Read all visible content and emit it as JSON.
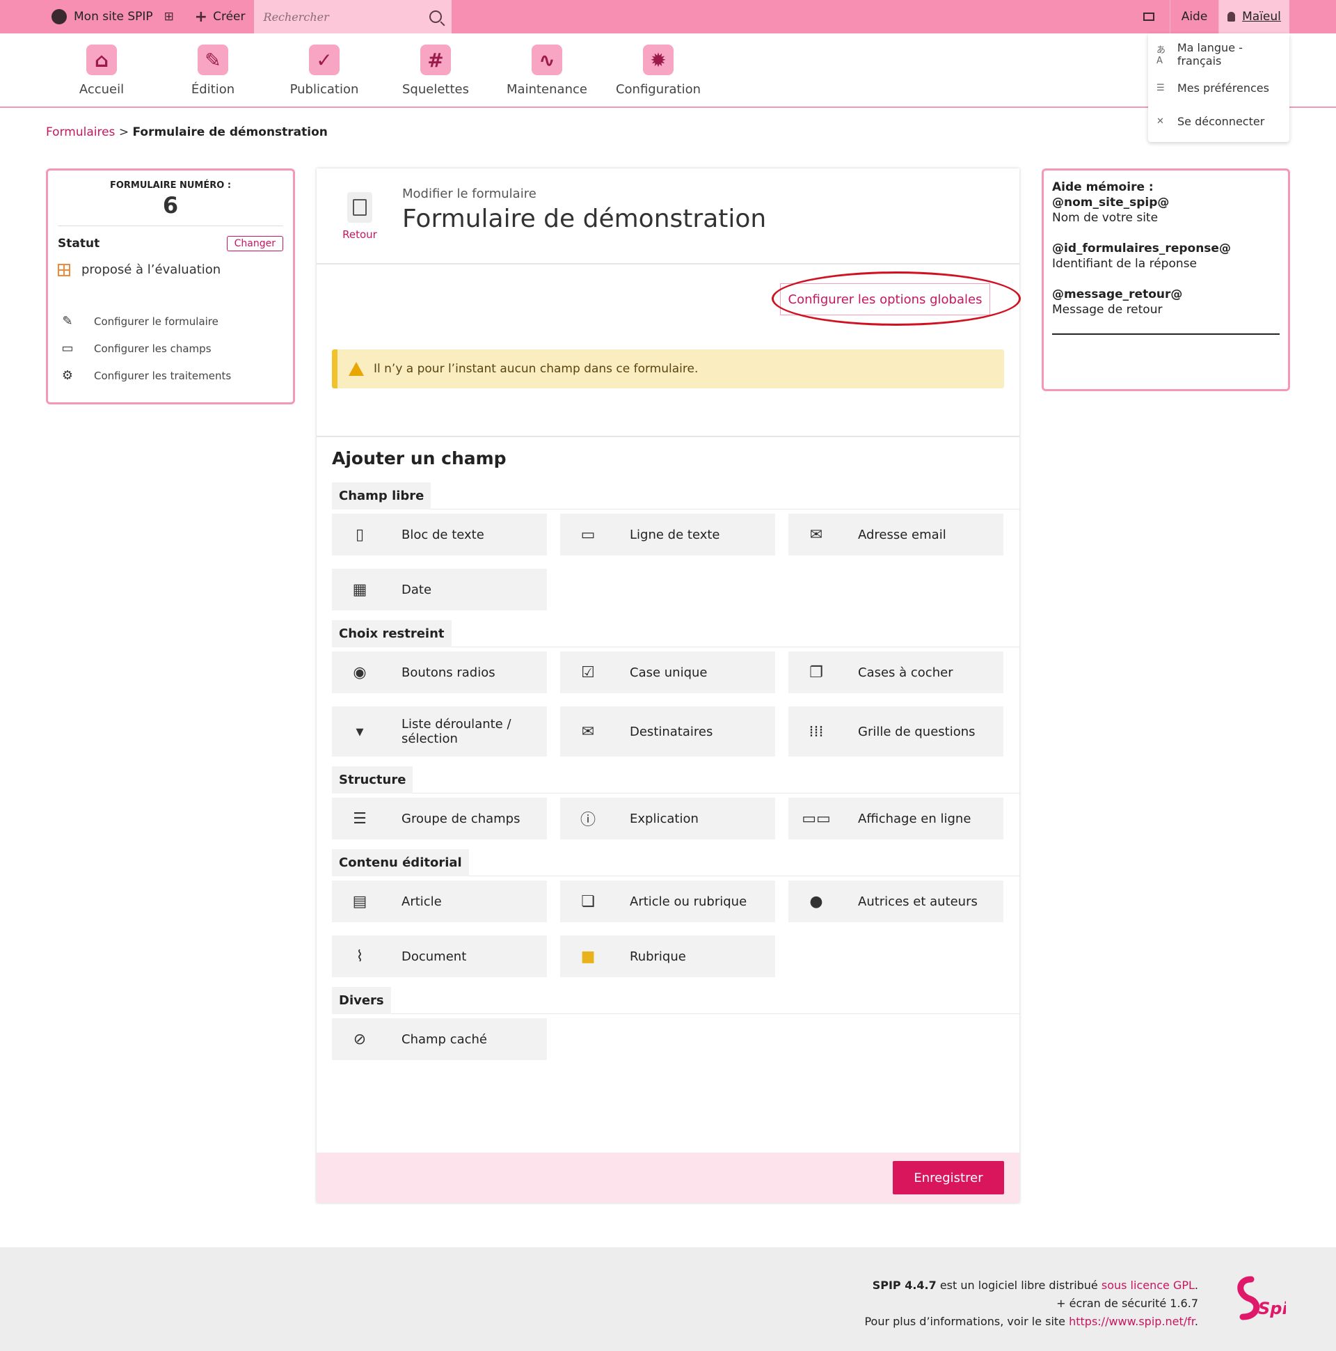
{
  "topbar": {
    "site": "Mon site SPIP",
    "create": "Créer",
    "search_placeholder": "Rechercher",
    "help": "Aide",
    "user": "Maïeul"
  },
  "user_menu": [
    {
      "label": "Ma langue - français",
      "icon": "translate-icon"
    },
    {
      "label": "Mes préférences",
      "icon": "preferences-icon"
    },
    {
      "label": "Se déconnecter",
      "icon": "logout-icon"
    }
  ],
  "mainnav": [
    {
      "label": "Accueil",
      "icon": "home-icon"
    },
    {
      "label": "Édition",
      "icon": "edit-icon"
    },
    {
      "label": "Publication",
      "icon": "publish-icon"
    },
    {
      "label": "Squelettes",
      "icon": "hash-icon"
    },
    {
      "label": "Maintenance",
      "icon": "pulse-icon"
    },
    {
      "label": "Configuration",
      "icon": "gear-icon"
    }
  ],
  "breadcrumb": {
    "parent": "Formulaires",
    "separator": ">",
    "current": "Formulaire de démonstration"
  },
  "leftbox": {
    "number_label": "FORMULAIRE NUMÉRO :",
    "number": "6",
    "status_label": "Statut",
    "change": "Changer",
    "status_value": "proposé à l’évaluation",
    "links": [
      "Configurer le formulaire",
      "Configurer les champs",
      "Configurer les traitements"
    ]
  },
  "center": {
    "back": "Retour",
    "subtitle": "Modifier le formulaire",
    "title": "Formulaire de démonstration",
    "global_options": "Configurer les options globales",
    "alert": "Il n’y a pour l’instant aucun champ dans ce formulaire.",
    "add_title": "Ajouter un champ",
    "groups": [
      {
        "label": "Champ libre",
        "items": [
          "Bloc de texte",
          "Ligne de texte",
          "Adresse email",
          "Date"
        ]
      },
      {
        "label": "Choix restreint",
        "items": [
          "Boutons radios",
          "Case unique",
          "Cases à cocher",
          "Liste déroulante / sélection",
          "Destinataires",
          "Grille de questions"
        ]
      },
      {
        "label": "Structure",
        "items": [
          "Groupe de champs",
          "Explication",
          "Affichage en ligne"
        ]
      },
      {
        "label": "Contenu éditorial",
        "items": [
          "Article",
          "Article ou rubrique",
          "Autrices et auteurs",
          "Document",
          "Rubrique"
        ]
      },
      {
        "label": "Divers",
        "items": [
          "Champ caché"
        ]
      }
    ],
    "save": "Enregistrer"
  },
  "rightbox": {
    "title": "Aide mémoire :",
    "entries": [
      {
        "key": "@nom_site_spip@",
        "desc": "Nom de votre site"
      },
      {
        "key": "@id_formulaires_reponse@",
        "desc": "Identifiant de la réponse"
      },
      {
        "key": "@message_retour@",
        "desc": "Message de retour"
      }
    ]
  },
  "footer": {
    "version": "SPIP 4.4.7",
    "line1_mid": " est un logiciel libre distribué ",
    "license": "sous licence GPL",
    "line1_end": ".",
    "line2": "+ écran de sécurité 1.6.7",
    "line3_start": "Pour plus d’informations, voir le site ",
    "url": "https://www.spip.net/fr",
    "line3_end": ".",
    "logo_text": "Spip"
  },
  "colors": {
    "accent": "#c6165f",
    "topbar": "#f78fb2",
    "save": "#d9155c",
    "alert_bg": "#faedc0",
    "highlight_ring": "#d11020"
  }
}
